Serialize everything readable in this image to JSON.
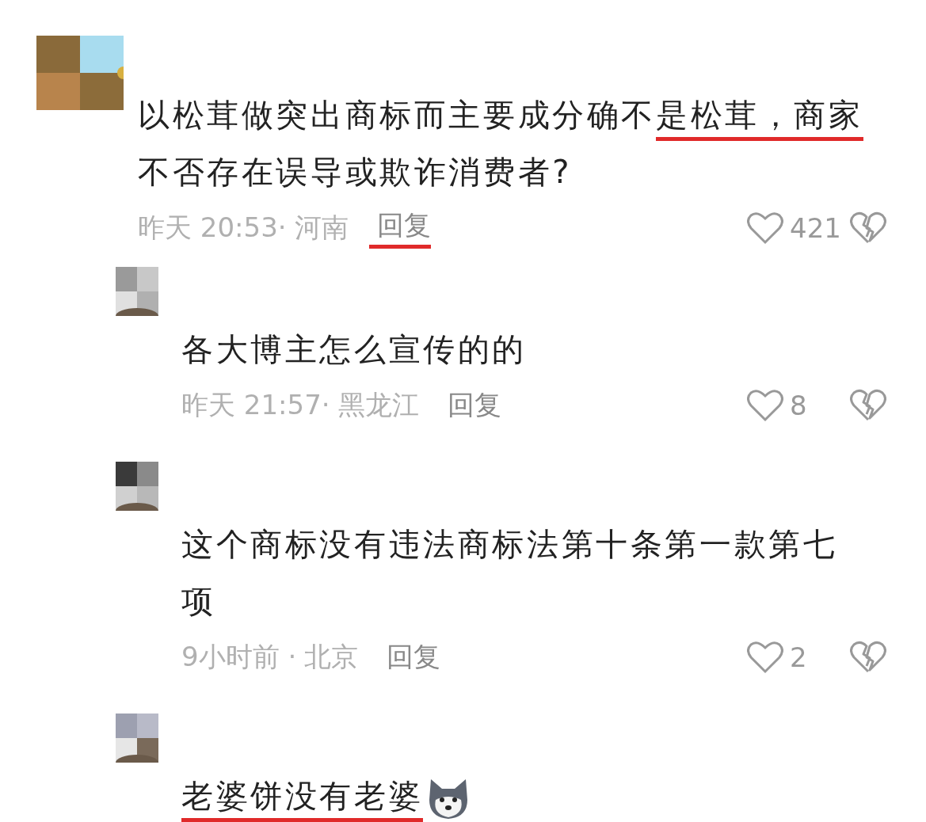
{
  "comments": [
    {
      "text": [
        {
          "text": "以松茸做突出商标而主要成分确不",
          "underlined": false
        },
        {
          "text": "是松茸，商家",
          "underlined": true
        },
        {
          "text": "不否存在误导或欺诈消费者?",
          "underlined": false
        }
      ],
      "time": "昨天 20:53·",
      "location": "河南",
      "reply": "回复",
      "reply_struck": true,
      "likes": "421",
      "children": [
        {
          "text": [
            {
              "text": "各大博主怎么宣传的的",
              "underlined": false
            }
          ],
          "time": "昨天 21:57·",
          "location": "黑龙江",
          "reply": "回复",
          "reply_struck": false,
          "likes": "8"
        },
        {
          "text": [
            {
              "text": "这个商标没有违法商标法第十条第一款第七项",
              "underlined": false
            }
          ],
          "time": "9小时前 ·",
          "location": "北京",
          "reply": "回复",
          "reply_struck": false,
          "likes": "2"
        },
        {
          "text": [
            {
              "text": "老婆饼没有老婆",
              "underlined": true
            }
          ],
          "emoji": true
        }
      ]
    }
  ]
}
